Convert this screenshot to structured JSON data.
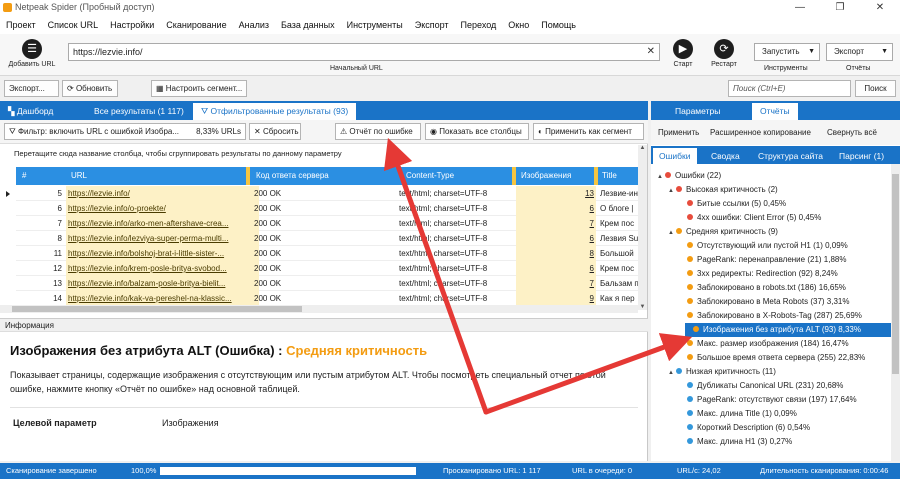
{
  "window": {
    "title": "Netpeak Spider (Пробный доступ)",
    "controls": [
      "—",
      "❐",
      "✕"
    ]
  },
  "menu": [
    "Проект",
    "Список URL",
    "Настройки",
    "Сканирование",
    "Анализ",
    "База данных",
    "Инструменты",
    "Экспорт",
    "Переход",
    "Окно",
    "Помощь"
  ],
  "toolbar": {
    "add_url": "Добавить URL",
    "url_value": "https://lezvie.info/",
    "url_caption": "Начальный URL",
    "start": "Старт",
    "restart": "Рестарт",
    "tools_dd": "Запустить",
    "tools_caption": "Инструменты",
    "reports_dd": "Экспорт",
    "reports_caption": "Отчёты"
  },
  "secondary": {
    "export": "Экспорт...",
    "refresh": "Обновить",
    "segments": "Настроить сегмент...",
    "search_placeholder": "Поиск (Ctrl+E)",
    "search_btn": "Поиск"
  },
  "left": {
    "tabs": [
      "Дашборд",
      "Все результаты (1 117)",
      "Отфильтрованные результаты (93)"
    ],
    "filter": {
      "filter_label": "Фильтр: включить URL с ошибкой Изобра...",
      "percent": "8,33% URLs",
      "reset": "Сбросить",
      "report": "Отчёт по ошибке",
      "show_all": "Показать все столбцы",
      "apply": "Применить как сегмент"
    },
    "group_hint": "Перетащите сюда название столбца, чтобы сгруппировать результаты по данному параметру",
    "columns": [
      "#",
      "URL",
      "Код ответа сервера",
      "Content-Type",
      "Изображения",
      "Title"
    ],
    "rows": [
      {
        "n": "5",
        "url": "https://lezvie.info/",
        "code": "200 OK",
        "type": "text/html; charset=UTF-8",
        "img": "13",
        "title": "Лезвие-ин"
      },
      {
        "n": "6",
        "url": "https://lezvie.info/o-proekte/",
        "code": "200 OK",
        "type": "text/html; charset=UTF-8",
        "img": "6",
        "title": "О блоге |"
      },
      {
        "n": "7",
        "url": "https://lezvie.info/arko-men-aftershave-crea...",
        "code": "200 OK",
        "type": "text/html; charset=UTF-8",
        "img": "7",
        "title": "Крем пос"
      },
      {
        "n": "8",
        "url": "https://lezvie.info/lezviya-super-perma-multi...",
        "code": "200 OK",
        "type": "text/html; charset=UTF-8",
        "img": "6",
        "title": "Лезвия Su"
      },
      {
        "n": "11",
        "url": "https://lezvie.info/bolshoj-brat-i-little-sister-...",
        "code": "200 OK",
        "type": "text/html; charset=UTF-8",
        "img": "8",
        "title": "Большой"
      },
      {
        "n": "12",
        "url": "https://lezvie.info/krem-posle-britya-svobod...",
        "code": "200 OK",
        "type": "text/html; charset=UTF-8",
        "img": "6",
        "title": "Крем пос"
      },
      {
        "n": "13",
        "url": "https://lezvie.info/balzam-posle-britya-bielit...",
        "code": "200 OK",
        "type": "text/html; charset=UTF-8",
        "img": "7",
        "title": "Бальзам п"
      },
      {
        "n": "14",
        "url": "https://lezvie.info/kak-va-pereshel-na-klassic...",
        "code": "200 OK",
        "type": "text/html; charset=UTF-8",
        "img": "9",
        "title": "Как я пер"
      }
    ],
    "info": {
      "header": "Информация",
      "title": "Изображения без атрибута ALT (Ошибка) :",
      "severity": "Средняя критичность",
      "desc": "Показывает страницы, содержащие изображения с отсутствующим или пустым атрибутом ALT. Чтобы посмотреть специальный отчет по этой ошибке, нажмите кнопку «Отчёт по ошибке» над основной таблицей.",
      "param_label": "Целевой параметр",
      "param_value": "Изображения"
    }
  },
  "right": {
    "tabs": [
      "Параметры",
      "Отчёты"
    ],
    "actions": [
      "Применить",
      "Расширенное копирование",
      "Свернуть всё"
    ],
    "subtabs": [
      "Ошибки",
      "Сводка",
      "Структура сайта",
      "Парсинг (1)"
    ],
    "tree": [
      {
        "label": "Ошибки (22)",
        "color": "#e74c3c",
        "level": 0,
        "toggle": "▲"
      },
      {
        "label": "Высокая критичность (2)",
        "color": "#e74c3c",
        "level": 1,
        "toggle": "▲"
      },
      {
        "label": "Битые ссылки (5) 0,45%",
        "color": "#e74c3c",
        "level": 2,
        "toggle": ""
      },
      {
        "label": "4xx ошибки: Client Error (5) 0,45%",
        "color": "#e74c3c",
        "level": 2,
        "toggle": ""
      },
      {
        "label": "Средняя критичность (9)",
        "color": "#f39c12",
        "level": 1,
        "toggle": "▲"
      },
      {
        "label": "Отсутствующий или пустой H1 (1) 0,09%",
        "color": "#f39c12",
        "level": 2,
        "toggle": ""
      },
      {
        "label": "PageRank: перенаправление (21) 1,88%",
        "color": "#f39c12",
        "level": 2,
        "toggle": ""
      },
      {
        "label": "3xx редиректы: Redirection (92) 8,24%",
        "color": "#f39c12",
        "level": 2,
        "toggle": ""
      },
      {
        "label": "Заблокировано в robots.txt (186) 16,65%",
        "color": "#f39c12",
        "level": 2,
        "toggle": ""
      },
      {
        "label": "Заблокировано в Meta Robots (37) 3,31%",
        "color": "#f39c12",
        "level": 2,
        "toggle": ""
      },
      {
        "label": "Заблокировано в X-Robots-Tag (287) 25,69%",
        "color": "#f39c12",
        "level": 2,
        "toggle": ""
      },
      {
        "label": "Изображения без атрибута ALT (93) 8,33%",
        "color": "#f39c12",
        "level": 2,
        "toggle": "",
        "selected": true
      },
      {
        "label": "Макс. размер изображения (184) 16,47%",
        "color": "#f39c12",
        "level": 2,
        "toggle": ""
      },
      {
        "label": "Большое время ответа сервера (255) 22,83%",
        "color": "#f39c12",
        "level": 2,
        "toggle": ""
      },
      {
        "label": "Низкая критичность (11)",
        "color": "#3498db",
        "level": 1,
        "toggle": "▲"
      },
      {
        "label": "Дубликаты Canonical URL (231) 20,68%",
        "color": "#3498db",
        "level": 2,
        "toggle": ""
      },
      {
        "label": "PageRank: отсутствуют связи (197) 17,64%",
        "color": "#3498db",
        "level": 2,
        "toggle": ""
      },
      {
        "label": "Макс. длина Title (1) 0,09%",
        "color": "#3498db",
        "level": 2,
        "toggle": ""
      },
      {
        "label": "Короткий Description (6) 0,54%",
        "color": "#3498db",
        "level": 2,
        "toggle": ""
      },
      {
        "label": "Макс. длина H1 (3) 0,27%",
        "color": "#3498db",
        "level": 2,
        "toggle": ""
      }
    ]
  },
  "status": {
    "scan_done": "Сканирование завершено",
    "progress_pct": "100,0%",
    "progress_value": 1.0,
    "scanned": "Просканировано URL: 1 117",
    "queue": "URL в очереди: 0",
    "rate": "URL/с: 24,02",
    "duration": "Длительность сканирования: 0:00:46"
  },
  "colors": {
    "accent": "#1a73c7",
    "highlight_col": "#fdf1c6",
    "annotation_arrow": "#e53935",
    "severity_medium": "#f39c12"
  }
}
